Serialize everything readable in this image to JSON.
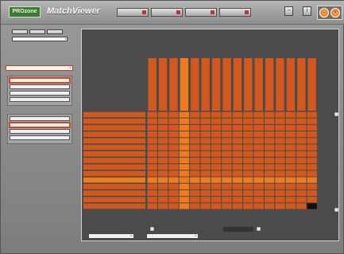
{
  "app": {
    "logo": "PROzone",
    "title": "MatchViewer",
    "tabs": [
      "",
      "",
      "",
      ""
    ],
    "window_buttons": [
      "",
      ""
    ]
  },
  "sidebar": {
    "view_buttons": [
      "",
      "",
      ""
    ],
    "team_select": "",
    "mode_select": "",
    "group1": [
      "",
      "",
      "",
      ""
    ],
    "group2": [
      "",
      "",
      "",
      ""
    ],
    "group1_selected": 0,
    "group2_selected": 1
  },
  "colors": {
    "accent": "#d6531f",
    "accent_light": "#e8701f",
    "bar": "#d2581e",
    "frame": "#4b4b4b",
    "highlight": "#f07b1f"
  },
  "matrix": {
    "rows": 15,
    "cols": 16,
    "highlight_col": 3,
    "highlight_row": 10,
    "column_heads": [
      "",
      "",
      "",
      "",
      "",
      "",
      "",
      "",
      "",
      "",
      "",
      "",
      "",
      "",
      "",
      ""
    ],
    "row_labels": [
      "",
      "",
      "",
      "",
      "",
      "",
      "",
      "",
      "",
      "",
      "",
      "",
      "",
      "",
      ""
    ]
  },
  "footer": {
    "left_select": "",
    "right_select": "",
    "label": "",
    "sub_label": ""
  }
}
